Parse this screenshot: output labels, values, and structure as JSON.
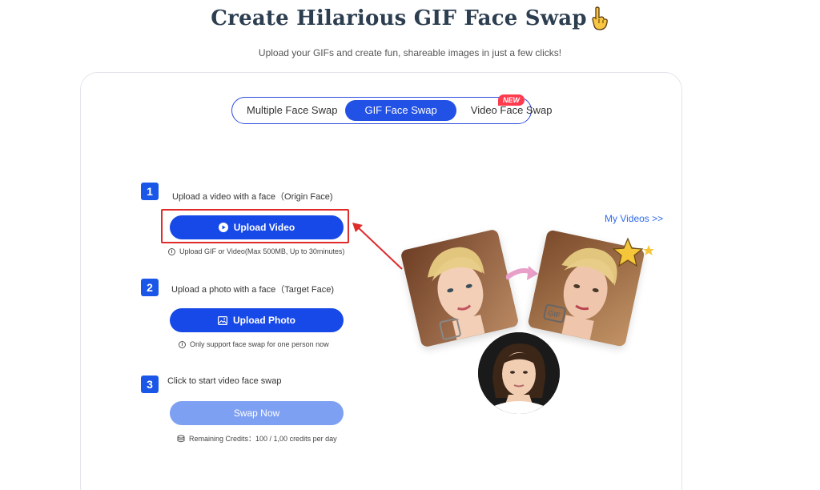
{
  "header": {
    "title": "Create Hilarious GIF Face Swap",
    "title_icon": "pointing-down-hand-icon",
    "subtitle": "Upload your GIFs and create fun, shareable images in just a few clicks!"
  },
  "tabs": [
    {
      "label": "Multiple Face Swap",
      "active": false
    },
    {
      "label": "GIF Face Swap",
      "active": true
    },
    {
      "label": "Video Face Swap",
      "active": false,
      "badge": "NEW"
    }
  ],
  "steps": [
    {
      "number": "1",
      "label": "Upload a video with a face（Origin Face)",
      "button_label": "Upload Video",
      "button_icon": "play-circle-icon",
      "hint": "Upload GIF or Video(Max 500MB, Up to 30minutes)"
    },
    {
      "number": "2",
      "label": "Upload a photo with a face（Target Face)",
      "button_label": "Upload Photo",
      "button_icon": "image-icon",
      "hint": "Only support face swap for one person now"
    },
    {
      "number": "3",
      "label": "Click to start video face swap",
      "button_label": "Swap Now",
      "hint": "Remaining Credits：100 / 1,00 credits per day"
    }
  ],
  "my_videos_link": "My Videos >>",
  "illustration": {
    "gif_badge": "GIF",
    "colors": {
      "accent": "#1748e8",
      "highlight": "#e02b2b",
      "arrow": "#e8a0c8",
      "star": "#f5c63a"
    }
  }
}
